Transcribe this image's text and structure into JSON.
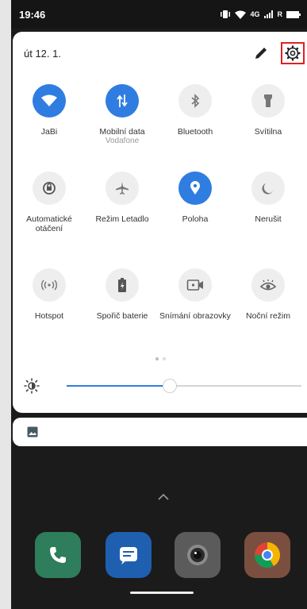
{
  "status_bar": {
    "time": "19:46",
    "network": "4G",
    "roaming": "R"
  },
  "panel": {
    "date": "út 12. 1."
  },
  "tiles": [
    {
      "label": "JaBi",
      "sub": "",
      "icon": "wifi-icon",
      "active": true
    },
    {
      "label": "Mobilní data",
      "sub": "Vodafone",
      "icon": "mobile-data-icon",
      "active": true
    },
    {
      "label": "Bluetooth",
      "sub": "",
      "icon": "bluetooth-icon",
      "active": false
    },
    {
      "label": "Svítilna",
      "sub": "",
      "icon": "flashlight-icon",
      "active": false
    },
    {
      "label": "Automatické otáčení",
      "sub": "",
      "icon": "auto-rotate-icon",
      "active": false
    },
    {
      "label": "Režim Letadlo",
      "sub": "",
      "icon": "airplane-icon",
      "active": false
    },
    {
      "label": "Poloha",
      "sub": "",
      "icon": "location-icon",
      "active": true
    },
    {
      "label": "Nerušit",
      "sub": "",
      "icon": "moon-icon",
      "active": false
    },
    {
      "label": "Hotspot",
      "sub": "",
      "icon": "hotspot-icon",
      "active": false
    },
    {
      "label": "Spořič baterie",
      "sub": "",
      "icon": "battery-saver-icon",
      "active": false
    },
    {
      "label": "Snímání obrazovky",
      "sub": "",
      "icon": "screen-record-icon",
      "active": false
    },
    {
      "label": "Noční režim",
      "sub": "",
      "icon": "eye-icon",
      "active": false
    }
  ],
  "pagination": {
    "current": 1,
    "total": 2
  },
  "brightness": {
    "level": 0.44
  },
  "colors": {
    "accent": "#2f7de1",
    "inactive_tile": "#eeeeee",
    "highlight": "#dd2222"
  },
  "dock_apps": [
    "phone-app-icon",
    "messages-app-icon",
    "camera-app-icon",
    "chrome-app-icon"
  ]
}
